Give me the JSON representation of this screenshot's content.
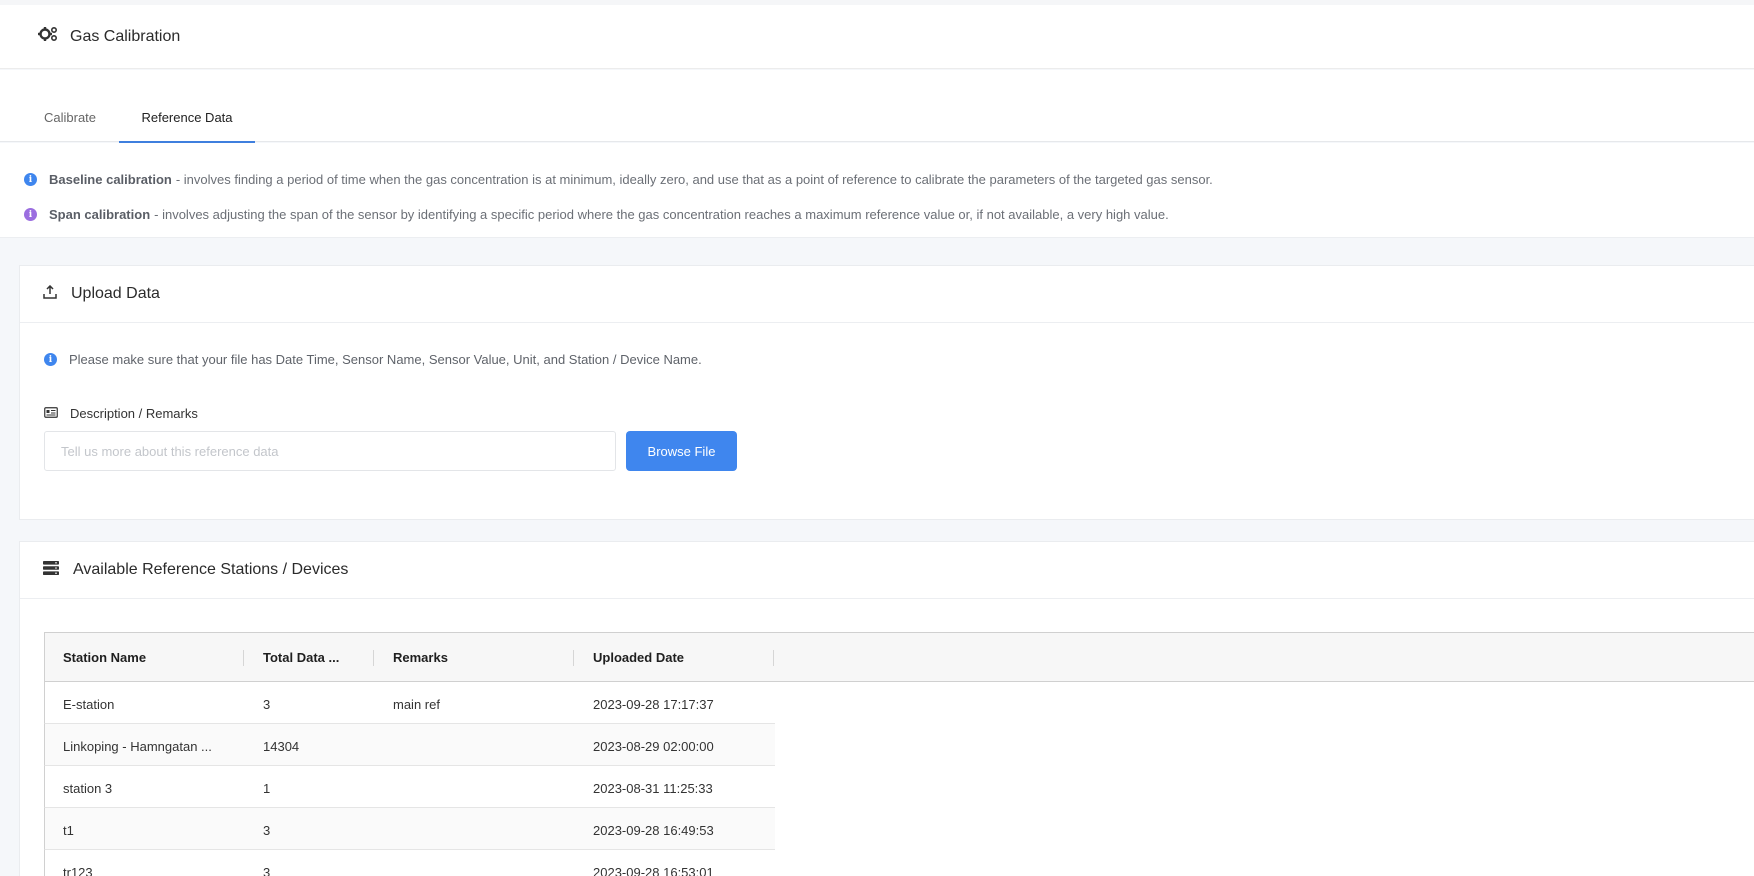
{
  "header": {
    "title": "Gas Calibration",
    "icon": "gears-icon"
  },
  "tabs": [
    {
      "label": "Calibrate",
      "active": false
    },
    {
      "label": "Reference Data",
      "active": true
    }
  ],
  "info": {
    "baseline": {
      "title": "Baseline calibration",
      "text": "- involves finding a period of time when the gas concentration is at minimum, ideally zero, and use that as a point of reference to calibrate the parameters of the targeted gas sensor.",
      "icon_color": "#3f86ee"
    },
    "span": {
      "title": "Span calibration",
      "text": "- involves adjusting the span of the sensor by identifying a specific period where the gas concentration reaches a maximum reference value or, if not available, a very high value.",
      "icon_color": "#9b6ee0"
    }
  },
  "upload": {
    "title": "Upload Data",
    "note": "Please make sure that your file has Date Time, Sensor Name, Sensor Value, Unit, and Station / Device Name.",
    "desc_label": "Description / Remarks",
    "desc_placeholder": "Tell us more about this reference data",
    "desc_value": "",
    "browse_label": "Browse File"
  },
  "stations": {
    "title": "Available Reference Stations / Devices",
    "columns": [
      "Station Name",
      "Total Data ...",
      "Remarks",
      "Uploaded Date"
    ],
    "rows": [
      [
        "E-station",
        "3",
        "main ref",
        "2023-09-28 17:17:37"
      ],
      [
        "Linkoping - Hamngatan ...",
        "14304",
        "",
        "2023-08-29 02:00:00"
      ],
      [
        "station 3",
        "1",
        "",
        "2023-08-31 11:25:33"
      ],
      [
        "t1",
        "3",
        "",
        "2023-09-28 16:49:53"
      ],
      [
        "tr123",
        "3",
        "",
        "2023-09-28 16:53:01"
      ]
    ]
  }
}
